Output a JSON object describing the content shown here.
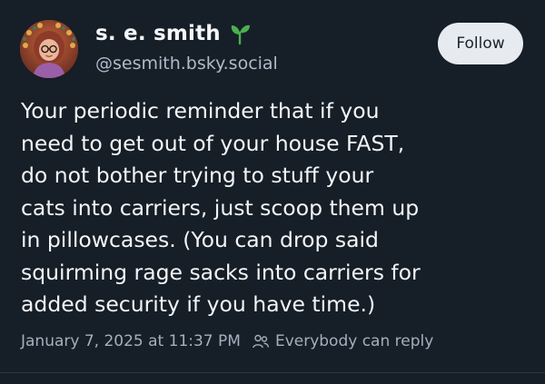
{
  "post": {
    "author": {
      "display_name": "s. e. smith",
      "handle": "@sesmith.bsky.social",
      "badge_icon": "sprout-icon"
    },
    "follow_label": "Follow",
    "text_lines": [
      "Your periodic reminder that if you",
      "need to get out of your house FAST,",
      "do not bother trying to stuff your",
      "cats into carriers, just scoop them up",
      "in pillowcases. (You can drop said",
      "squirming rage sacks into carriers for",
      "added security if you have time.)"
    ],
    "timestamp": "January 7, 2025 at 11:37 PM",
    "reply_setting_icon": "people-icon",
    "reply_setting": "Everybody can reply"
  },
  "colors": {
    "background": "#161e27",
    "text": "#f3f5f7",
    "muted": "#a3b0bd",
    "button_bg": "#e7ebef",
    "sprout": "#4caf50"
  }
}
